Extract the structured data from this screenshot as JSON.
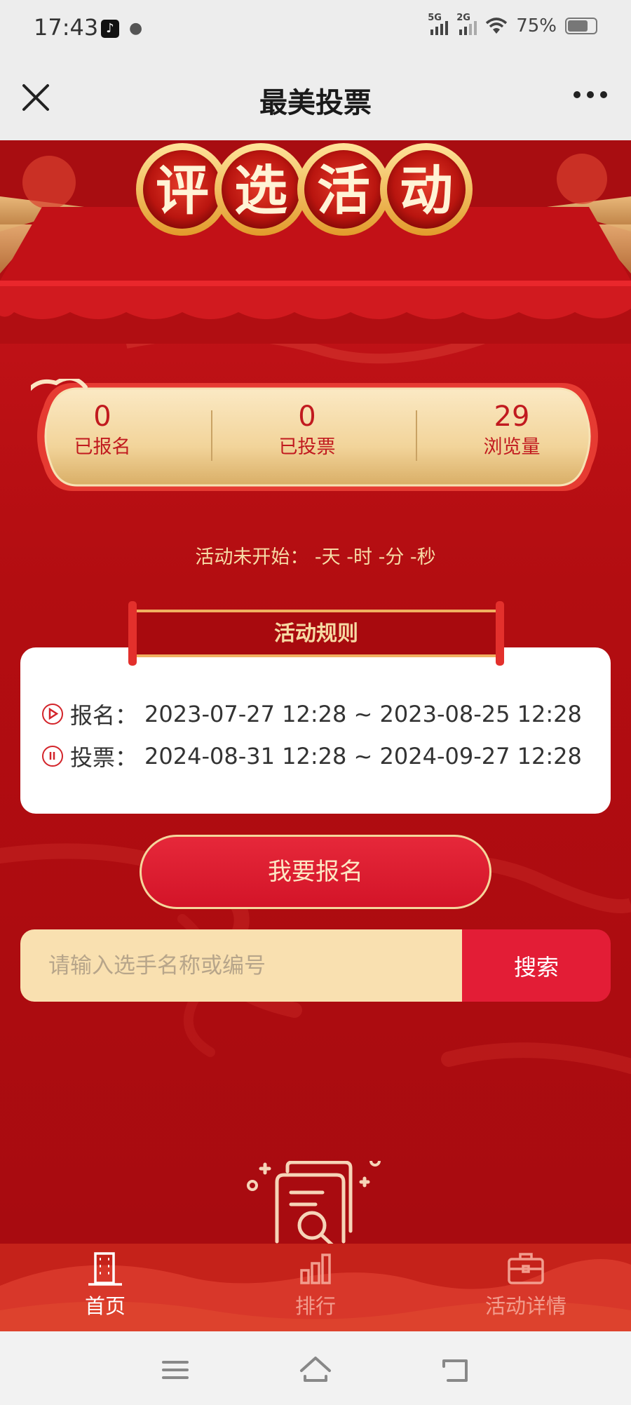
{
  "status_bar": {
    "time": "17:43",
    "signal_1": "5G",
    "signal_2": "2G",
    "battery": "75%"
  },
  "nav": {
    "title": "最美投票",
    "close_icon": "close-icon",
    "more_icon": "more-icon"
  },
  "banner": {
    "title": "评选活动",
    "chars": [
      "评",
      "选",
      "活",
      "动"
    ]
  },
  "stats": [
    {
      "value": "0",
      "label": "已报名"
    },
    {
      "value": "0",
      "label": "已投票"
    },
    {
      "value": "29",
      "label": "浏览量"
    }
  ],
  "countdown": "活动未开始：  -天 -时 -分 -秒",
  "rules": {
    "title": "活动规则",
    "signup_label": "报名：",
    "signup_range": "2023-07-27 12:28 ~ 2023-08-25 12:28",
    "vote_label": "投票：",
    "vote_range": "2024-08-31 12:28 ~ 2024-09-27 12:28"
  },
  "signup_button": "我要报名",
  "search": {
    "placeholder": "请输入选手名称或编号",
    "button": "搜索"
  },
  "tabs": [
    {
      "label": "首页",
      "icon": "building-icon",
      "active": true
    },
    {
      "label": "排行",
      "icon": "bar-chart-icon",
      "active": false
    },
    {
      "label": "活动详情",
      "icon": "briefcase-icon",
      "active": false
    }
  ],
  "colors": {
    "brand_red": "#c8151a",
    "gold": "#f5d69c",
    "button_red": "#e31d36"
  }
}
